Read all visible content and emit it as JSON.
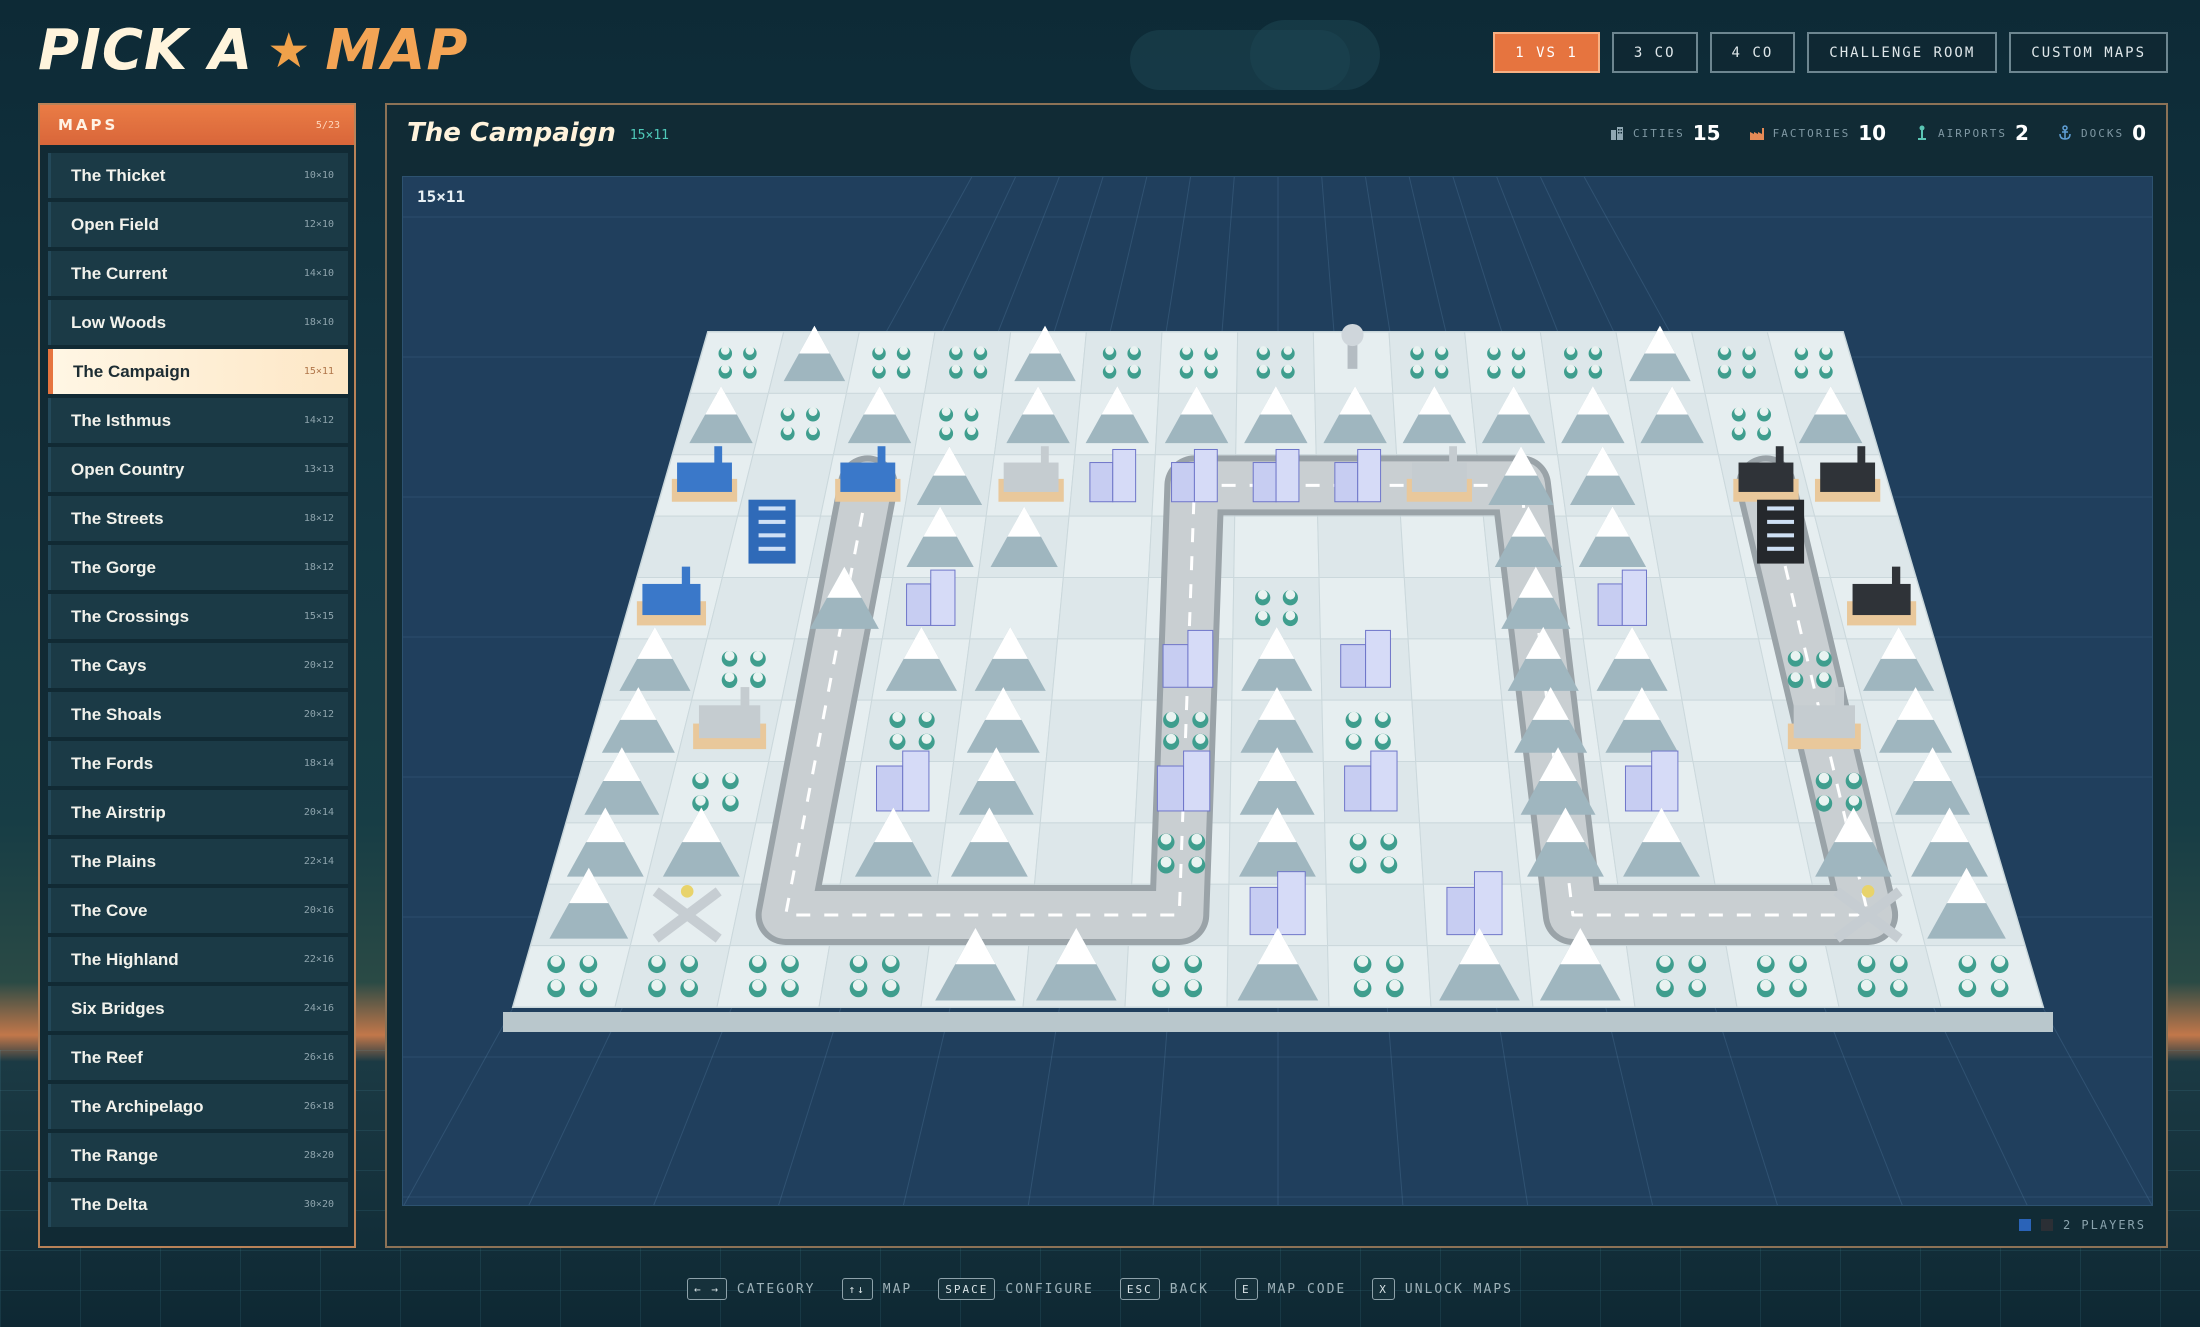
{
  "title": {
    "word1": "PICK A",
    "word2": "MAP",
    "star_icon": "star-icon"
  },
  "tabs": [
    {
      "label": "1 VS 1",
      "active": true
    },
    {
      "label": "3 CO",
      "active": false
    },
    {
      "label": "4 CO",
      "active": false
    },
    {
      "label": "CHALLENGE ROOM",
      "active": false
    },
    {
      "label": "CUSTOM MAPS",
      "active": false
    }
  ],
  "sidebar": {
    "header": "MAPS",
    "count": "5/23",
    "items": [
      {
        "name": "The Thicket",
        "size": "10×10"
      },
      {
        "name": "Open Field",
        "size": "12×10"
      },
      {
        "name": "The Current",
        "size": "14×10"
      },
      {
        "name": "Low Woods",
        "size": "18×10"
      },
      {
        "name": "The Campaign",
        "size": "15×11",
        "selected": true
      },
      {
        "name": "The Isthmus",
        "size": "14×12"
      },
      {
        "name": "Open Country",
        "size": "13×13"
      },
      {
        "name": "The Streets",
        "size": "18×12"
      },
      {
        "name": "The Gorge",
        "size": "18×12"
      },
      {
        "name": "The Crossings",
        "size": "15×15"
      },
      {
        "name": "The Cays",
        "size": "20×12"
      },
      {
        "name": "The Shoals",
        "size": "20×12"
      },
      {
        "name": "The Fords",
        "size": "18×14"
      },
      {
        "name": "The Airstrip",
        "size": "20×14"
      },
      {
        "name": "The Plains",
        "size": "22×14"
      },
      {
        "name": "The Cove",
        "size": "20×16"
      },
      {
        "name": "The Highland",
        "size": "22×16"
      },
      {
        "name": "Six Bridges",
        "size": "24×16"
      },
      {
        "name": "The Reef",
        "size": "26×16"
      },
      {
        "name": "The Archipelago",
        "size": "26×18"
      },
      {
        "name": "The Range",
        "size": "28×20"
      },
      {
        "name": "The Delta",
        "size": "30×20"
      }
    ]
  },
  "main": {
    "map_title": "The Campaign",
    "map_dim": "15×11",
    "viewport_dim": "15×11",
    "stats": [
      {
        "icon": "city-icon",
        "label": "CITIES",
        "value": "15"
      },
      {
        "icon": "factory-icon",
        "label": "FACTORIES",
        "value": "10"
      },
      {
        "icon": "airport-icon",
        "label": "AIRPORTS",
        "value": "2"
      },
      {
        "icon": "anchor-icon",
        "label": "DOCKS",
        "value": "0"
      }
    ],
    "players": "2 PLAYERS",
    "colors": {
      "blue_team": "#2a63b8",
      "black_team": "#2b2f35",
      "accent": "#e6743f"
    }
  },
  "footer": [
    {
      "key": "← →",
      "label": "CATEGORY"
    },
    {
      "key": "↑↓",
      "label": "MAP"
    },
    {
      "key": "SPACE",
      "label": "CONFIGURE"
    },
    {
      "key": "ESC",
      "label": "BACK"
    },
    {
      "key": "E",
      "label": "MAP CODE"
    },
    {
      "key": "X",
      "label": "UNLOCK MAPS"
    }
  ]
}
